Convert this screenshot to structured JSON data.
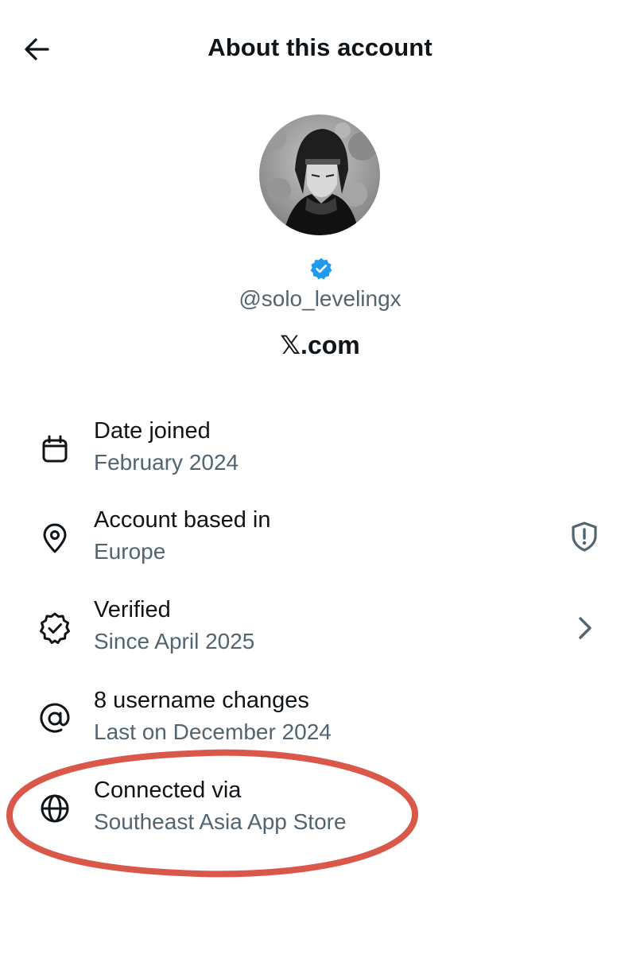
{
  "header": {
    "title": "About this account",
    "back_icon": "arrow-left-icon"
  },
  "profile": {
    "avatar": "avatar-image",
    "verified_icon": "verified-badge-icon",
    "verified_color": "#1d9bf0",
    "handle": "@solo_levelingx",
    "site": "𝕏.com"
  },
  "rows": {
    "date_joined": {
      "icon": "calendar-icon",
      "title": "Date joined",
      "value": "February 2024"
    },
    "based_in": {
      "icon": "location-pin-icon",
      "title": "Account based in",
      "value": "Europe",
      "trailing_icon": "shield-alert-icon"
    },
    "verified": {
      "icon": "verified-outline-icon",
      "title": "Verified",
      "value": "Since April 2025",
      "trailing_icon": "chevron-right-icon"
    },
    "username_changes": {
      "icon": "at-sign-icon",
      "title": "8 username changes",
      "value": "Last on December 2024"
    },
    "connected_via": {
      "icon": "globe-icon",
      "title": "Connected via",
      "value": "Southeast Asia App Store"
    }
  },
  "colors": {
    "text_primary": "#0f1419",
    "text_secondary": "#536471",
    "highlight": "#d9584a"
  },
  "annotation": {
    "type": "hand-drawn red ellipse",
    "target": "Connected via"
  }
}
